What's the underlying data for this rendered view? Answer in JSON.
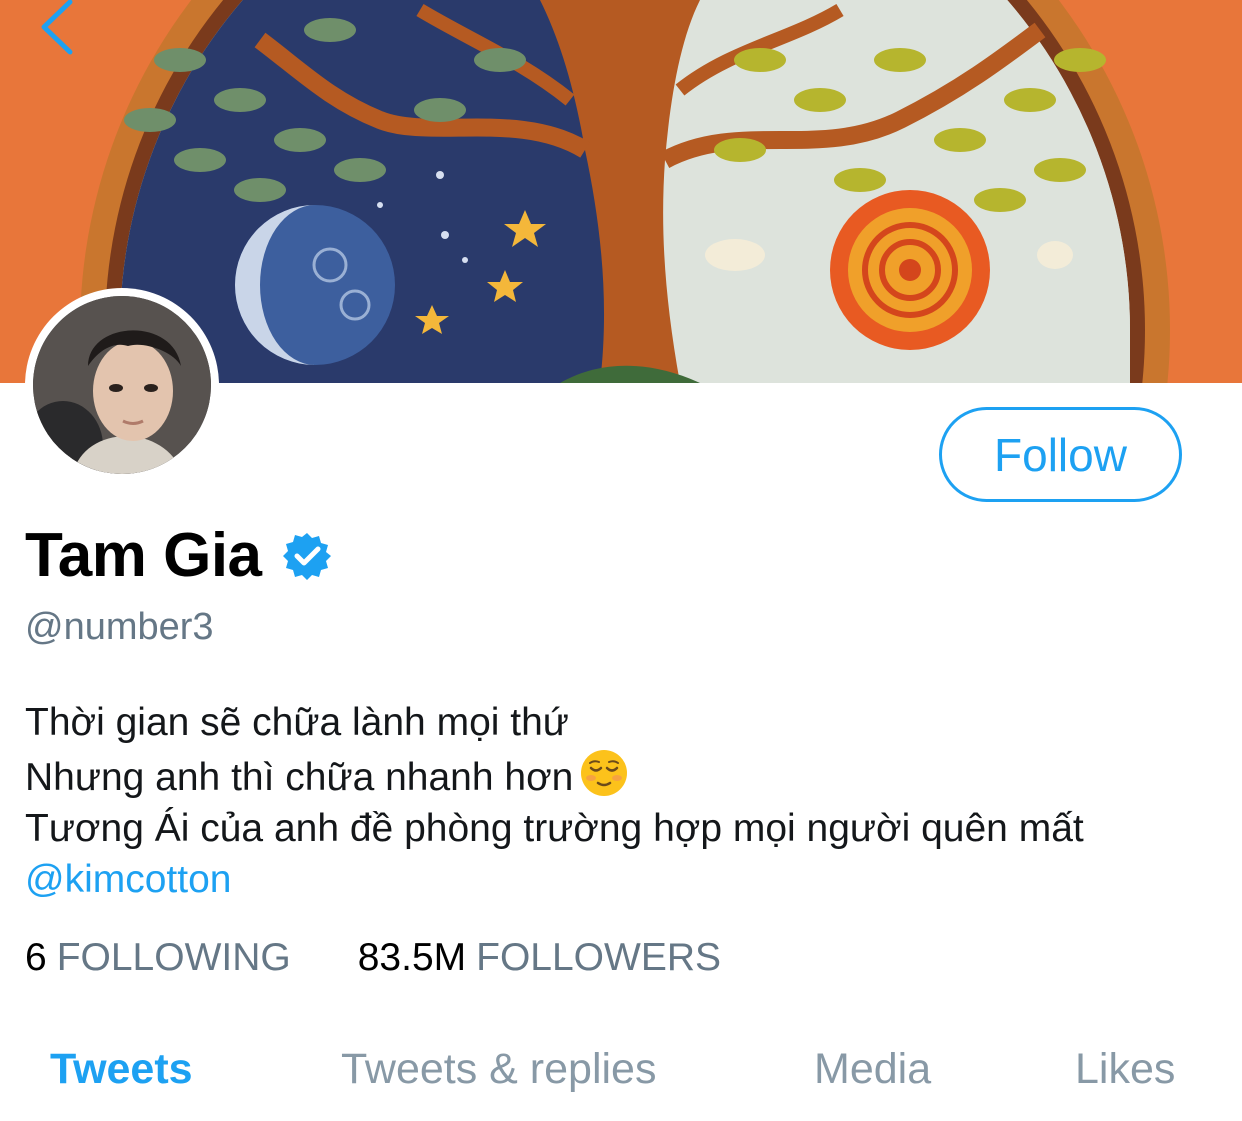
{
  "profile": {
    "display_name": "Tam Gia",
    "handle": "@number3",
    "verified": true,
    "follow_label": "Follow"
  },
  "bio": {
    "line1": "Thời gian sẽ chữa lành mọi thứ",
    "line2": "Nhưng anh thì chữa nhanh hơn",
    "line2_emoji": "relieved-face-emoji",
    "line3": "Tương Ái của anh đề phòng trường hợp mọi người quên mất",
    "mention": "@kimcotton"
  },
  "stats": {
    "following_count": "6",
    "following_label": "FOLLOWING",
    "followers_count": "83.5M",
    "followers_label": "FOLLOWERS"
  },
  "tabs": [
    {
      "label": "Tweets",
      "active": true
    },
    {
      "label": "Tweets & replies",
      "active": false
    },
    {
      "label": "Media",
      "active": false
    },
    {
      "label": "Likes",
      "active": false
    }
  ],
  "colors": {
    "accent": "#1da1f2",
    "secondary_text": "#657786",
    "banner_orange": "#e8763a"
  }
}
